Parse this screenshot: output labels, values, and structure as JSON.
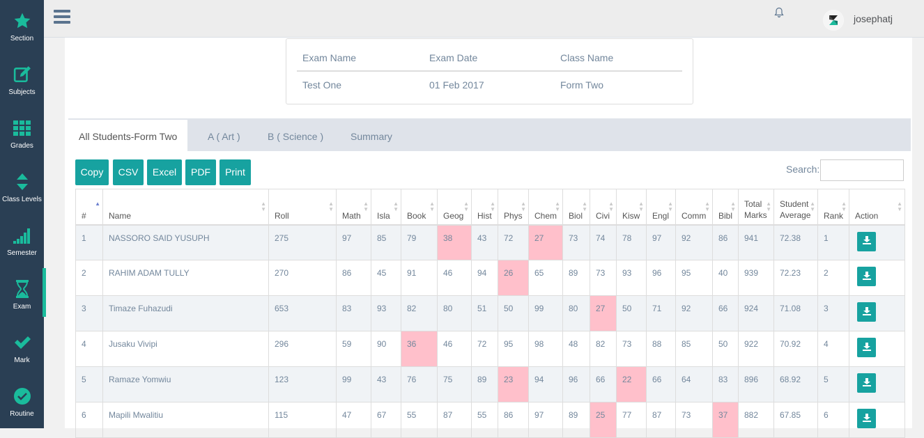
{
  "sidebar": {
    "items": [
      {
        "label": "Section",
        "icon": "star-icon"
      },
      {
        "label": "Subjects",
        "icon": "edit-icon"
      },
      {
        "label": "Grades",
        "icon": "grid-icon"
      },
      {
        "label": "Class Levels",
        "icon": "sort-icon"
      },
      {
        "label": "Semester",
        "icon": "signal-icon"
      },
      {
        "label": "Exam",
        "icon": "hourglass-icon"
      },
      {
        "label": "Mark",
        "icon": "check-icon"
      },
      {
        "label": "Routine",
        "icon": "check-circle-icon"
      }
    ]
  },
  "topbar": {
    "username": "josephatj"
  },
  "exam_info": {
    "headers": [
      "Exam Name",
      "Exam Date",
      "Class Name"
    ],
    "values": [
      "Test One",
      "01 Feb 2017",
      "Form Two"
    ]
  },
  "tabs": [
    "All Students-Form Two",
    "A ( Art )",
    "B ( Science )",
    "Summary"
  ],
  "buttons": [
    "Copy",
    "CSV",
    "Excel",
    "PDF",
    "Print"
  ],
  "search": {
    "label": "Search:",
    "value": ""
  },
  "table": {
    "columns": [
      "#",
      "Name",
      "Roll",
      "Math",
      "Isla",
      "Book",
      "Geog",
      "Hist",
      "Phys",
      "Chem",
      "Biol",
      "Civi",
      "Kisw",
      "Engl",
      "Comm",
      "Bibl",
      "Total Marks",
      "Student Average",
      "Rank",
      "Action"
    ],
    "rows": [
      [
        "1",
        "NASSORO SAID YUSUPH",
        "275",
        "97",
        "85",
        "79",
        "38",
        "43",
        "72",
        "27",
        "73",
        "74",
        "78",
        "97",
        "92",
        "86",
        "941",
        "72.38",
        "1"
      ],
      [
        "2",
        "RAHIM ADAM TULLY",
        "270",
        "86",
        "45",
        "91",
        "46",
        "94",
        "26",
        "65",
        "89",
        "73",
        "93",
        "96",
        "95",
        "40",
        "939",
        "72.23",
        "2"
      ],
      [
        "3",
        "Timaze Fuhazudi",
        "653",
        "83",
        "93",
        "82",
        "80",
        "51",
        "50",
        "99",
        "80",
        "27",
        "50",
        "71",
        "92",
        "66",
        "924",
        "71.08",
        "3"
      ],
      [
        "4",
        "Jusaku Vivipi",
        "296",
        "59",
        "90",
        "36",
        "46",
        "72",
        "95",
        "98",
        "48",
        "82",
        "73",
        "88",
        "85",
        "50",
        "922",
        "70.92",
        "4"
      ],
      [
        "5",
        "Ramaze Yomwiu",
        "123",
        "99",
        "43",
        "76",
        "75",
        "89",
        "23",
        "94",
        "96",
        "66",
        "22",
        "66",
        "64",
        "83",
        "896",
        "68.92",
        "5"
      ],
      [
        "6",
        "Mapili Mwalitiu",
        "115",
        "47",
        "67",
        "55",
        "87",
        "55",
        "86",
        "97",
        "89",
        "25",
        "77",
        "87",
        "73",
        "37",
        "882",
        "67.85",
        "6"
      ]
    ],
    "low_color": "#ffc0cb"
  },
  "colors": {
    "accent": "#17a2a0",
    "sidebar": "#2a3f54",
    "sidebar_icon": "#1abb9c"
  }
}
